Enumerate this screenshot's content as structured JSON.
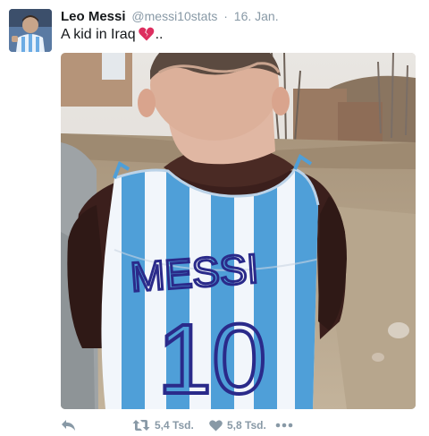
{
  "tweet": {
    "author_name": "Leo Messi",
    "handle": "@messi10stats",
    "separator": "·",
    "date": "16. Jan.",
    "text": "A kid in Iraq",
    "emoji": "broken-heart",
    "text_suffix": "..",
    "media": {
      "shirt_name": "MESSI",
      "shirt_number": "10"
    },
    "actions": {
      "retweet_count": "5,4 Tsd.",
      "like_count": "5,8 Tsd."
    }
  },
  "colors": {
    "muted": "#8899a6",
    "text": "#14171a",
    "heart": "#e0245e"
  }
}
